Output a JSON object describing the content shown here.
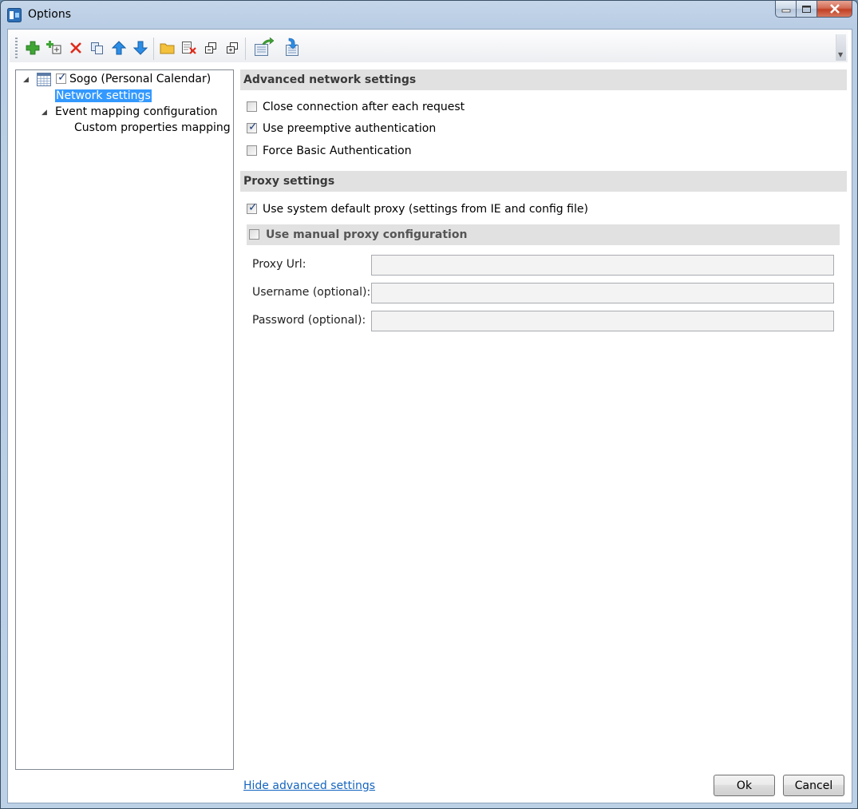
{
  "window": {
    "title": "Options"
  },
  "toolbar": {
    "buttons": [
      {
        "icon": "add-icon"
      },
      {
        "icon": "add-multiple-icon"
      },
      {
        "icon": "delete-icon"
      },
      {
        "icon": "copy-icon"
      },
      {
        "icon": "move-up-icon"
      },
      {
        "icon": "move-down-icon"
      },
      {
        "icon": "open-folder-icon"
      },
      {
        "icon": "clear-cache-icon"
      },
      {
        "icon": "expand-all-icon"
      },
      {
        "icon": "collapse-all-icon"
      },
      {
        "icon": "export-icon"
      },
      {
        "icon": "import-icon"
      }
    ]
  },
  "tree": {
    "root": {
      "label": "Sogo (Personal Calendar)",
      "checked": true
    },
    "items": [
      {
        "label": "Network settings",
        "selected": true
      },
      {
        "label": "Event mapping configuration"
      },
      {
        "label": "Custom properties mapping"
      }
    ]
  },
  "advanced": {
    "header": "Advanced network settings",
    "options": [
      {
        "label": "Close connection after each request",
        "checked": false
      },
      {
        "label": "Use preemptive authentication",
        "checked": true
      },
      {
        "label": "Force Basic Authentication",
        "checked": false
      }
    ]
  },
  "proxy": {
    "header": "Proxy settings",
    "system_default": {
      "label": "Use system default proxy (settings from IE and config file)",
      "checked": true
    },
    "manual": {
      "label": "Use manual proxy configuration",
      "checked": false
    },
    "fields": [
      {
        "label": "Proxy Url:",
        "value": ""
      },
      {
        "label": "Username (optional):",
        "value": ""
      },
      {
        "label": "Password (optional):",
        "value": ""
      }
    ]
  },
  "footer": {
    "hide_advanced": "Hide advanced settings",
    "ok": "Ok",
    "cancel": "Cancel"
  }
}
